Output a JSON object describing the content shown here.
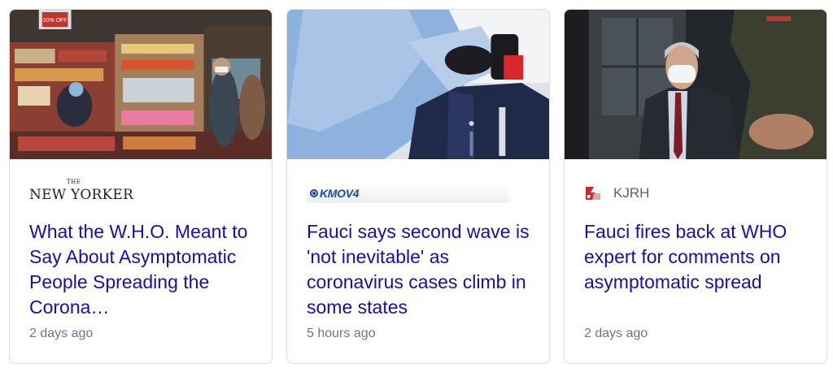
{
  "cards": [
    {
      "source": "NEW YORKER",
      "source_small": "THE",
      "title": "What the W.H.O. Meant to Say About Asymptomatic People Spreading the Corona…",
      "time": "2 days ago",
      "image_badge": "50% OFF"
    },
    {
      "source": "KMOV4",
      "title": "Fauci says second wave is 'not inevitable' as coronavirus cases climb in some states",
      "time": "5 hours ago"
    },
    {
      "source": "KJRH",
      "title": "Fauci fires back at WHO expert for comments on asymptomatic spread",
      "time": "2 days ago"
    }
  ],
  "colors": {
    "title": "#1a0dab",
    "time": "#70757a",
    "border": "#dadce0",
    "kmov": "#1a4aa5",
    "kjrh_red": "#d5242b"
  }
}
